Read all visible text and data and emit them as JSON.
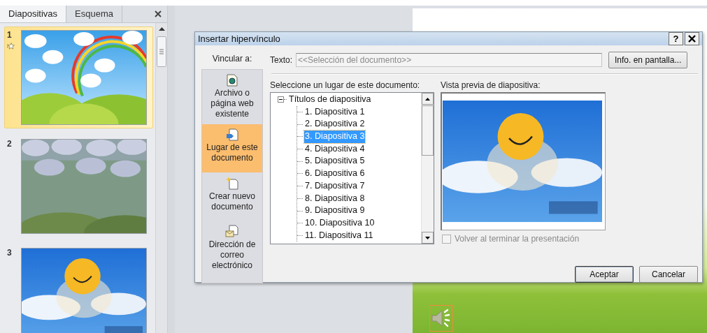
{
  "slides_panel": {
    "tabs": [
      {
        "label": "Diapositivas",
        "selected": true
      },
      {
        "label": "Esquema",
        "selected": false
      }
    ],
    "slides": [
      {
        "number": "1",
        "selected": true,
        "animated": true,
        "kind": "rainbow"
      },
      {
        "number": "2",
        "selected": false,
        "animated": false,
        "kind": "storm"
      },
      {
        "number": "3",
        "selected": false,
        "animated": false,
        "kind": "sun"
      }
    ]
  },
  "dialog": {
    "title": "Insertar hipervínculo",
    "help_button": "?",
    "link_to_label": "Vincular a:",
    "text_label": "Texto:",
    "text_field": {
      "value": "<<Selección del documento>>",
      "disabled": true
    },
    "screen_tip_button": "Info. en pantalla...",
    "link_targets": [
      {
        "label": "Archivo o página web existente",
        "kind": "file",
        "selected": false
      },
      {
        "label": "Lugar de este documento",
        "kind": "place",
        "selected": true
      },
      {
        "label": "Crear nuevo documento",
        "kind": "new",
        "selected": false
      },
      {
        "label": "Dirección de correo electrónico",
        "kind": "email",
        "selected": false
      }
    ],
    "place_label": "Seleccione un lugar de este documento:",
    "tree": [
      {
        "label": "Títulos de diapositiva",
        "expanded": true,
        "selected": false,
        "children": [
          {
            "label": "1. Diapositiva 1",
            "selected": false
          },
          {
            "label": "2. Diapositiva 2",
            "selected": false
          },
          {
            "label": "3. Diapositiva 3",
            "selected": true
          },
          {
            "label": "4. Diapositiva 4",
            "selected": false
          },
          {
            "label": "5. Diapositiva 5",
            "selected": false
          },
          {
            "label": "6. Diapositiva 6",
            "selected": false
          },
          {
            "label": "7. Diapositiva 7",
            "selected": false
          },
          {
            "label": "8. Diapositiva 8",
            "selected": false
          },
          {
            "label": "9. Diapositiva 9",
            "selected": false
          },
          {
            "label": "10. Diapositiva 10",
            "selected": false
          },
          {
            "label": "11. Diapositiva 11",
            "selected": false
          }
        ]
      }
    ],
    "preview_label": "Vista previa de diapositiva:",
    "preview": {
      "kind": "sun"
    },
    "return_checkbox": {
      "label": "Volver al terminar la presentación",
      "checked": false,
      "disabled": true
    },
    "buttons": [
      "Aceptar",
      "Cancelar"
    ]
  }
}
